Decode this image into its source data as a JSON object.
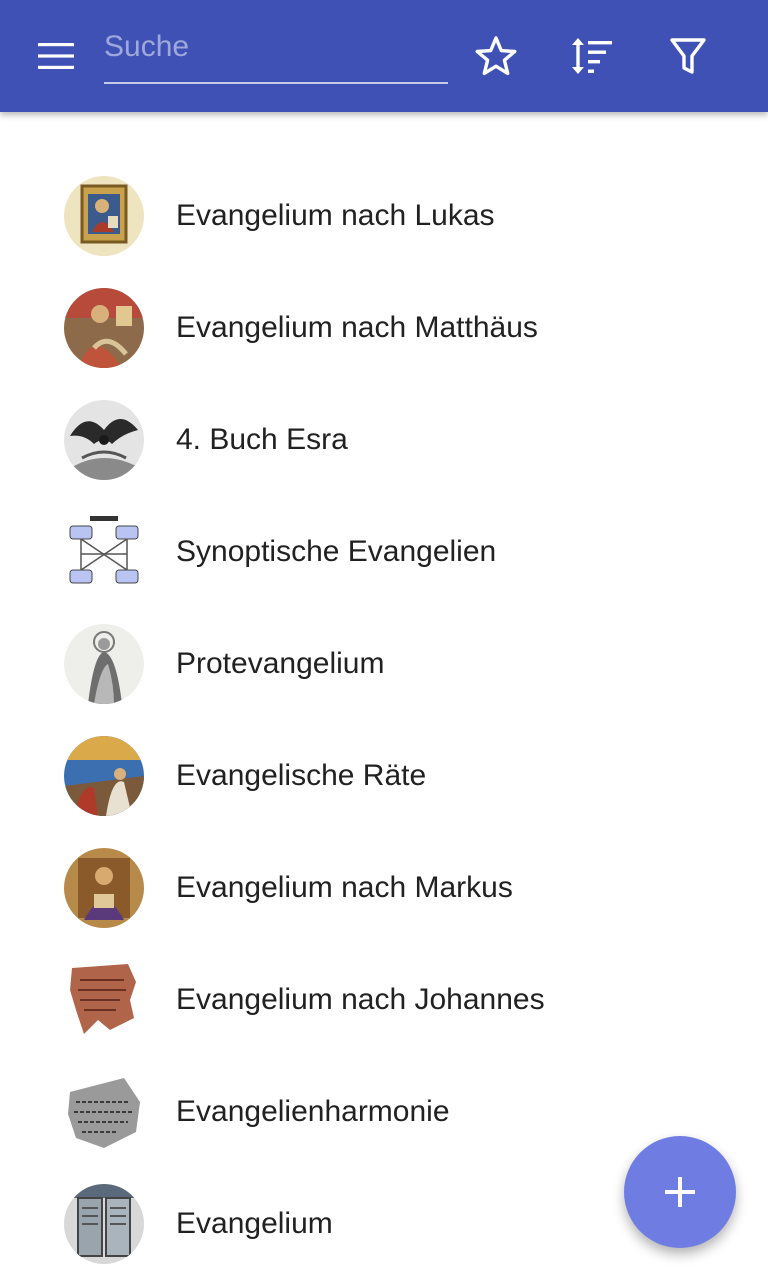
{
  "colors": {
    "toolbar": "#3f51b5",
    "fab": "#6f7de3",
    "text": "#212121",
    "placeholder": "#9fa8da"
  },
  "toolbar": {
    "menu_icon": "menu-icon",
    "search": {
      "placeholder": "Suche",
      "value": ""
    },
    "favorites_icon": "star-outline-icon",
    "sort_icon": "sort-icon",
    "filter_icon": "filter-icon"
  },
  "list": {
    "items": [
      {
        "label": "Evangelium nach Lukas",
        "thumbnail": "evangelist-miniature"
      },
      {
        "label": "Evangelium nach Matthäus",
        "thumbnail": "evangelist-miniature"
      },
      {
        "label": "4. Buch Esra",
        "thumbnail": "engraving"
      },
      {
        "label": "Synoptische Evangelien",
        "thumbnail": "synoptic-diagram"
      },
      {
        "label": "Protevangelium",
        "thumbnail": "engraving"
      },
      {
        "label": "Evangelische Räte",
        "thumbnail": "painting"
      },
      {
        "label": "Evangelium nach Markus",
        "thumbnail": "evangelist-miniature"
      },
      {
        "label": "Evangelium nach Johannes",
        "thumbnail": "papyrus-fragment"
      },
      {
        "label": "Evangelienharmonie",
        "thumbnail": "manuscript-fragment"
      },
      {
        "label": "Evangelium",
        "thumbnail": "book-photo"
      }
    ]
  },
  "fab": {
    "icon": "plus-icon"
  }
}
